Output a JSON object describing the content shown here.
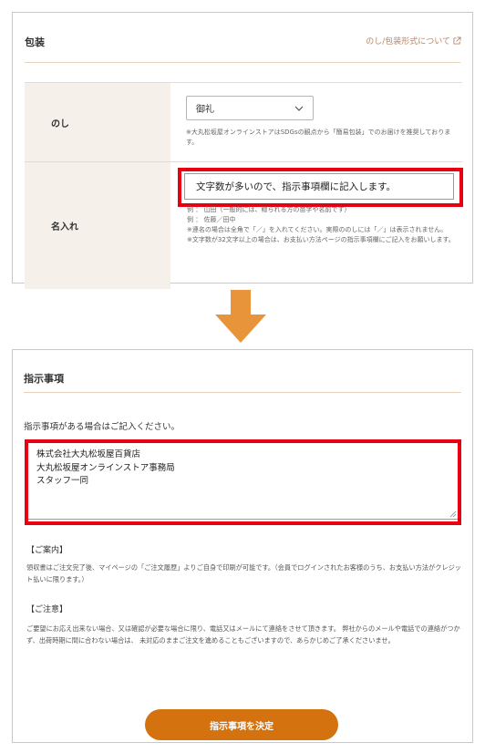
{
  "wrapping": {
    "title": "包装",
    "link_label": "のし/包装形式について",
    "noshi": {
      "label": "のし",
      "selected": "御礼",
      "note": "※大丸松坂屋オンラインストアはSDGsの観点から「簡易包装」でのお届けを推奨しております。"
    },
    "naire": {
      "label": "名入れ",
      "value": "文字数が多いので、指示事項欄に記入します。",
      "notes": [
        "例 ： 山田（一般的には、贈られる方の苗字や名前です）",
        "例 ： 佐藤／田中",
        "※連名の場合は全角で「／」を入れてください。実際ののしには「／」は表示されません。",
        "※文字数が32文字以上の場合は、お支払い方法ページの指示事項欄にご記入をお願いします。"
      ]
    }
  },
  "instructions": {
    "title": "指示事項",
    "subtitle": "指示事項がある場合はご記入ください。",
    "text_lines": [
      "株式会社大丸松坂屋百貨店",
      "大丸松坂屋オンラインストア事務局",
      "スタッフ一同"
    ],
    "guide_heading": "【ご案内】",
    "guide_text": "領収書はご注文完了後、マイページの「ご注文履歴」よりご自身で印刷が可能です。（会員でログインされたお客様のうち、お支払い方法がクレジット払いに限ります。）",
    "caution_heading": "【ご注意】",
    "caution_text": "ご要望にお応え出来ない場合、又は確認が必要な場合に限り、電話又はメールにて連絡をさせて頂きます。 弊社からのメールや電話での連絡がつかず、出荷時期に間に合わない場合は、 未対応のままご注文を進めることもございますので、あらかじめご了承くださいませ。",
    "submit_label": "指示事項を決定"
  },
  "colors": {
    "highlight": "#e60012",
    "accent_orange": "#d4720f",
    "arrow_orange": "#e8943a",
    "label_bg": "#f5f1ea",
    "link": "#b8866b"
  },
  "icons": [
    "external-link-icon",
    "chevron-down-icon",
    "down-arrow-icon",
    "resize-handle-icon"
  ]
}
